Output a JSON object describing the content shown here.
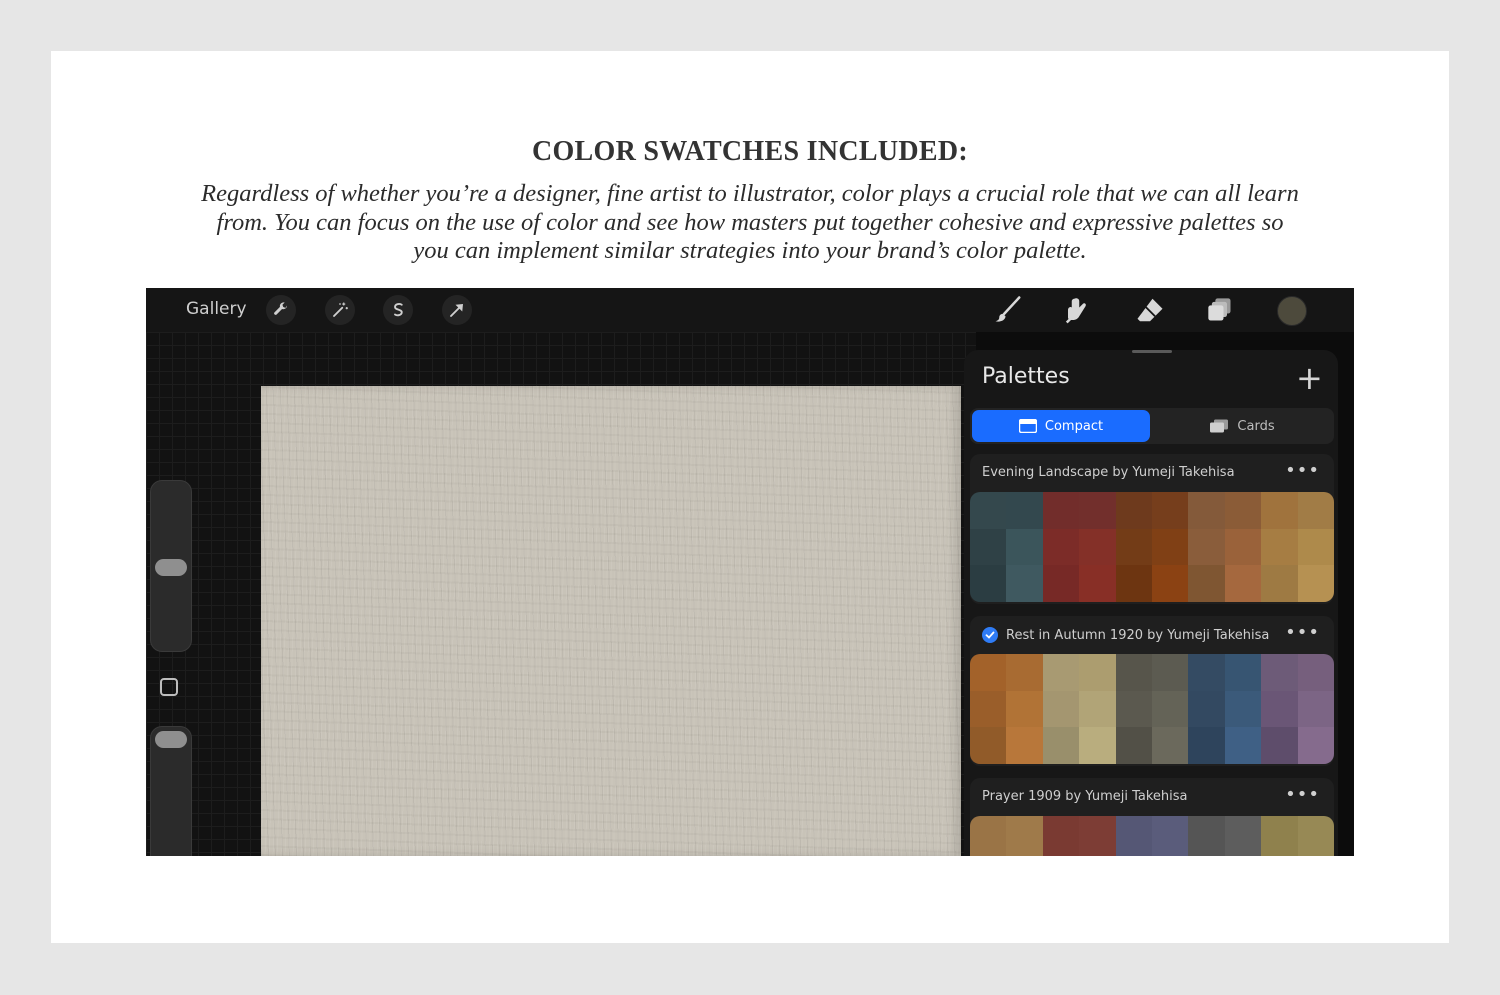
{
  "heading": "COLOR SWATCHES INCLUDED:",
  "description": "Regardless of whether you’re a designer, fine artist to illustrator, color plays a crucial role that we can all learn from. You can focus on the use of color and see how masters put together cohesive and expressive palettes so you can implement similar strategies into your brand’s color palette.",
  "topbar": {
    "gallery": "Gallery",
    "left_icons": [
      "wrench-icon",
      "magic-wand-icon",
      "selection-icon",
      "transform-arrow-icon"
    ],
    "right_icons": [
      "brush-icon",
      "smudge-icon",
      "eraser-icon",
      "layers-icon"
    ],
    "current_color": "#4d4a3c"
  },
  "panel": {
    "title": "Palettes",
    "tabs": {
      "compact": "Compact",
      "cards": "Cards"
    },
    "palettes": [
      {
        "name": "Evening Landscape by Yumeji Takehisa",
        "selected": false,
        "colors": [
          [
            "#34484d",
            "#33484e",
            "#722d2b",
            "#722f2c",
            "#6e3a1d",
            "#763e1c",
            "#845a3a",
            "#8b5c37",
            "#a0733d",
            "#a17c46"
          ],
          [
            "#2f4146",
            "#3b555b",
            "#7c2c28",
            "#843028",
            "#733c17",
            "#804015",
            "#8a5d3b",
            "#9a623a",
            "#a67d43",
            "#ae8a4b"
          ],
          [
            "#2b3d42",
            "#3f5960",
            "#772926",
            "#882f26",
            "#6d3511",
            "#8b4213",
            "#7f5632",
            "#a5683e",
            "#9e7a43",
            "#b69152"
          ]
        ]
      },
      {
        "name": "Rest in Autumn 1920 by Yumeji Takehisa",
        "selected": true,
        "colors": [
          [
            "#a3622a",
            "#a86b32",
            "#a89a72",
            "#ac9d6f",
            "#57554b",
            "#5c5b51",
            "#344b63",
            "#375572",
            "#6d5b78",
            "#765f7d"
          ],
          [
            "#9a5e2a",
            "#b17336",
            "#a49670",
            "#b1a477",
            "#5b594f",
            "#646357",
            "#334961",
            "#3b5a7a",
            "#6a5676",
            "#7c6585"
          ],
          [
            "#915b29",
            "#b8773a",
            "#998f6b",
            "#b9ad7e",
            "#525047",
            "#6b695c",
            "#2e445c",
            "#3f6085",
            "#5e4d6b",
            "#856b8d"
          ]
        ]
      },
      {
        "name": "Prayer 1909 by Yumeji Takehisa",
        "selected": false,
        "colors": [
          [
            "#9a7446",
            "#9f7a4a",
            "#7a3a32",
            "#7d3d35",
            "#555775",
            "#5a5c7b",
            "#555555",
            "#5d5d5d",
            "#8f814d",
            "#978955"
          ],
          [
            "#9a7446",
            "#9f7a4a",
            "#7a3a32",
            "#7d3d35",
            "#555775",
            "#5a5c7b",
            "#555555",
            "#5d5d5d",
            "#8f814d",
            "#978955"
          ],
          [
            "#9a7446",
            "#9f7a4a",
            "#7a3a32",
            "#7d3d35",
            "#555775",
            "#5a5c7b",
            "#555555",
            "#5d5d5d",
            "#8f814d",
            "#978955"
          ]
        ]
      }
    ]
  }
}
